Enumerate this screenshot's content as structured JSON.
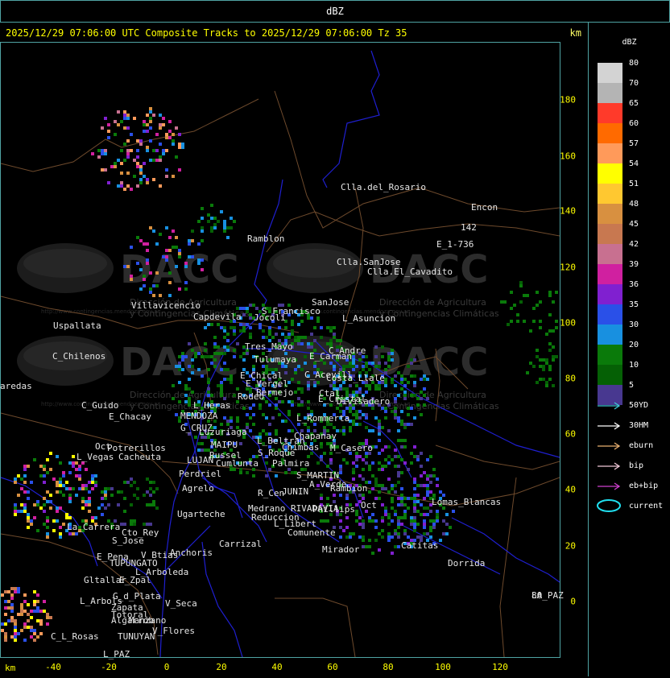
{
  "window": {
    "title": "dBZ"
  },
  "header": {
    "title": "2025/12/29 07:06:00 UTC Composite Tracks to 2025/12/29 07:06:00 Tz 35",
    "unit": "km"
  },
  "axes": {
    "x_unit": "km",
    "x_ticks": [
      "-40",
      "-20",
      "0",
      "20",
      "40",
      "60",
      "80",
      "100",
      "120"
    ],
    "y_ticks": [
      "180",
      "160",
      "140",
      "120",
      "100",
      "80",
      "60",
      "40",
      "20",
      "0"
    ]
  },
  "legend": {
    "title": "dBZ",
    "scale": [
      {
        "label": "80",
        "color": "#d3d3d3"
      },
      {
        "label": "70",
        "color": "#b4b4b4"
      },
      {
        "label": "65",
        "color": "#ff3a2a"
      },
      {
        "label": "60",
        "color": "#ff6a00"
      },
      {
        "label": "57",
        "color": "#ff9a5a"
      },
      {
        "label": "54",
        "color": "#ffff00"
      },
      {
        "label": "51",
        "color": "#ffc830"
      },
      {
        "label": "48",
        "color": "#d89040"
      },
      {
        "label": "45",
        "color": "#c87850"
      },
      {
        "label": "42",
        "color": "#c87090"
      },
      {
        "label": "39",
        "color": "#d020a0"
      },
      {
        "label": "36",
        "color": "#8020d0"
      },
      {
        "label": "35",
        "color": "#2a50e8"
      },
      {
        "label": "30",
        "color": "#1890e0"
      },
      {
        "label": "20",
        "color": "#0a7a0a"
      },
      {
        "label": "10",
        "color": "#056005"
      },
      {
        "label": "5",
        "color": "#483890"
      }
    ],
    "tracks": [
      {
        "label": "50YD",
        "color": "#40c8d8"
      },
      {
        "label": "30HM",
        "color": "#ffffff"
      },
      {
        "label": "eburn",
        "color": "#e8b070"
      },
      {
        "label": "bip",
        "color": "#f0c8d8"
      },
      {
        "label": "eb+bip",
        "color": "#d040d0"
      },
      {
        "label": "current",
        "color": "#20e0f0"
      }
    ]
  },
  "watermark": {
    "brand": "DACC",
    "line1": "Dirección de Agricultura",
    "line2": "y Contingencias Climáticas",
    "url": "http://www.contingencias.mendoza.gov.ar"
  },
  "map": {
    "places": [
      {
        "name": "Clla.del_Rosario"
      },
      {
        "name": "Encon"
      },
      {
        "name": "142"
      },
      {
        "name": "E_1-736"
      },
      {
        "name": "Ramblon"
      },
      {
        "name": "Clla.SanJose"
      },
      {
        "name": "Clla.El_Cavadito"
      },
      {
        "name": "Villavicencio"
      },
      {
        "name": "Capdevila"
      },
      {
        "name": "S_Francisco"
      },
      {
        "name": "Jocoli"
      },
      {
        "name": "SanJose"
      },
      {
        "name": "L_Asuncion"
      },
      {
        "name": "Uspallata"
      },
      {
        "name": "Tres_Mayo"
      },
      {
        "name": "Tulumaya"
      },
      {
        "name": "C_Andre"
      },
      {
        "name": "E_Carman"
      },
      {
        "name": "C_Chilenos"
      },
      {
        "name": "aredas"
      },
      {
        "name": "E_Chical"
      },
      {
        "name": "E_Vergel"
      },
      {
        "name": "C_Acevill"
      },
      {
        "name": "Costa_Llale"
      },
      {
        "name": "Bermejo"
      },
      {
        "name": "Rodeo"
      },
      {
        "name": "Ctal"
      },
      {
        "name": "Divisadero"
      },
      {
        "name": "C_Guido"
      },
      {
        "name": "L_Heras"
      },
      {
        "name": "E_Cristal"
      },
      {
        "name": "E_Chacay"
      },
      {
        "name": "MENDOZA"
      },
      {
        "name": "L_Rommerta"
      },
      {
        "name": "G_CRUZ"
      },
      {
        "name": "Luzuriaga"
      },
      {
        "name": "Chapanay"
      },
      {
        "name": "MAIPU"
      },
      {
        "name": "L_Beltran"
      },
      {
        "name": "Potrerillos"
      },
      {
        "name": "Russel"
      },
      {
        "name": "Chimbas"
      },
      {
        "name": "M_Casero"
      },
      {
        "name": "L_Vegas"
      },
      {
        "name": "Cacheuta"
      },
      {
        "name": "LUJAN"
      },
      {
        "name": "Cumlunta"
      },
      {
        "name": "S_Roque"
      },
      {
        "name": "Palmira"
      },
      {
        "name": "Perdriel"
      },
      {
        "name": "S_MARTIN"
      },
      {
        "name": "Agrelo"
      },
      {
        "name": "A_Verde"
      },
      {
        "name": "Rambion"
      },
      {
        "name": "R_Cen"
      },
      {
        "name": "JUNIN"
      },
      {
        "name": "Lomas_Blancas"
      },
      {
        "name": "Ugarteche"
      },
      {
        "name": "RIVADAVIA"
      },
      {
        "name": "Phillips"
      },
      {
        "name": "Oct"
      },
      {
        "name": "Medrano"
      },
      {
        "name": "Reduccion"
      },
      {
        "name": "L_Libert"
      },
      {
        "name": "LA_PAZ"
      },
      {
        "name": "La_Carrera"
      },
      {
        "name": "Cto_Rey"
      },
      {
        "name": "S_Jose"
      },
      {
        "name": "Carrizal"
      },
      {
        "name": "Comunente"
      },
      {
        "name": "Catitas"
      },
      {
        "name": "Anchoris"
      },
      {
        "name": "V_Btias"
      },
      {
        "name": "E_Pena"
      },
      {
        "name": "TUPUNGATO"
      },
      {
        "name": "Mirador"
      },
      {
        "name": "Dorrida"
      },
      {
        "name": "L_Arboleda"
      },
      {
        "name": "Gltallar"
      },
      {
        "name": "E_Zpal"
      },
      {
        "name": "G_d_Plata"
      },
      {
        "name": "L_Arbols"
      },
      {
        "name": "Zapata"
      },
      {
        "name": "Algarrob"
      },
      {
        "name": "V_Seca"
      },
      {
        "name": "Totoral"
      },
      {
        "name": "Manzano"
      },
      {
        "name": "C_L_Rosas"
      },
      {
        "name": "TUNUYAN"
      },
      {
        "name": "V_Flores"
      },
      {
        "name": "L_PAZ"
      },
      {
        "name": "80"
      },
      {
        "name": "Oct"
      }
    ]
  }
}
